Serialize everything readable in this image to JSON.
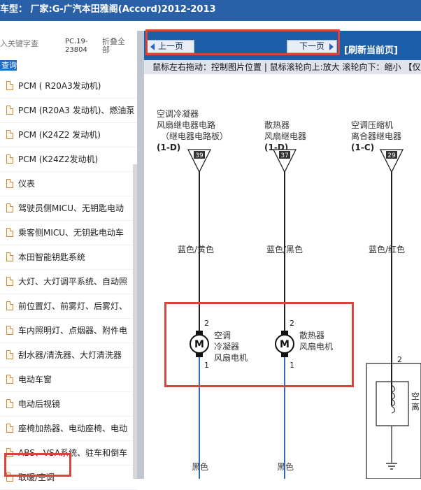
{
  "title": "车型：  厂家:G-广汽本田雅阁(Accord)2012-2013",
  "search": {
    "placeholder": "入关键字查",
    "query_button": "查询",
    "pc_code": "PC.19-23804",
    "fold_all": "折叠全部"
  },
  "list_items": [
    "PCM ( R20A3发动机)",
    "PCM (R20A3 发动机)、燃油泵",
    "PCM (K24Z2 发动机)",
    "PCM (K24Z2发动机)",
    "仪表",
    "驾驶员侧MICU、无钥匙电动",
    "乘客侧MICU、无钥匙电动车",
    "本田智能钥匙系统",
    "大灯、大灯调平系统、自动照",
    "前位置灯、前雾灯、后雾灯、",
    "车内照明灯、点烟器、附件电",
    "刮水器/清洗器、大灯清洗器",
    "电动车窗",
    "电动后视镜",
    "座椅加热器、电动座椅、电动",
    "ABS、VSA系统、驻车和倒车",
    "取暖/空调"
  ],
  "nav": {
    "prev": "上一页",
    "next": "下一页",
    "refresh": "[刷新当前页]",
    "hint": "鼠标左右拖动：控制图片位置 | 鼠标滚轮向上:放大  滚轮向下：缩小 【仅"
  },
  "diagram": {
    "relay1": {
      "lines": [
        "空调冷凝器",
        "风扇继电器电路",
        "（继电器电路板）"
      ],
      "code": "(1-D)",
      "pin": "39",
      "wire_top": "蓝色/黄色",
      "pin_top": "2",
      "pin_bottom": "1",
      "motor_lines": [
        "空调",
        "冷凝器",
        "风扇电机"
      ],
      "wire_bottom": "黑色"
    },
    "relay2": {
      "lines": [
        "散热器",
        "风扇继电器"
      ],
      "code": "(1-D)",
      "pin": "37",
      "wire_top": "蓝色/黑色",
      "pin_top": "2",
      "pin_bottom": "1",
      "motor_lines": [
        "散热器",
        "风扇电机"
      ],
      "wire_bottom": "黑色"
    },
    "relay3": {
      "lines": [
        "空调压缩机",
        "离合器继电器"
      ],
      "code": "(1-C)",
      "pin": "29",
      "wire_top": "蓝色/红色",
      "pin_top": "2",
      "clutch_label": [
        "空",
        "离"
      ]
    },
    "motor_symbol": "M"
  },
  "colors": {
    "titlebar": "#2a60a8",
    "navbar": "#1d5ea8",
    "highlight": "#d9443f",
    "wire_blue": "#2f6db5"
  }
}
